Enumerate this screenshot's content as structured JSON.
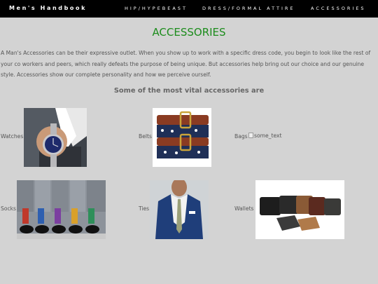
{
  "nav": {
    "brand": "Men's Handbook",
    "links": [
      "HIP/HYPEBEAST",
      "DRESS/FORMAL ATTIRE",
      "ACCESSORIES"
    ]
  },
  "main": {
    "title": "ACCESSORIES",
    "intro": "A Man's Accessories can be their expressive outlet. When you show up to work with a specific dress code, you begin to look like the rest of your co workers and peers, which really defeats the purpose of being unique. But accessories help bring out our choice and our genuine style. Accessories show our complete personality and how we perceive ourself.",
    "subtitle": "Some of the most vital accessories are"
  },
  "items": [
    {
      "label": "Watches"
    },
    {
      "label": "Belts"
    },
    {
      "label": "Bags",
      "broken_alt": "some_text"
    },
    {
      "label": "Socks"
    },
    {
      "label": "Ties"
    },
    {
      "label": "Wallets"
    }
  ],
  "colors": {
    "background": "#d3d3d3",
    "nav_bg": "#000000",
    "title_green": "#1c8c1c"
  }
}
